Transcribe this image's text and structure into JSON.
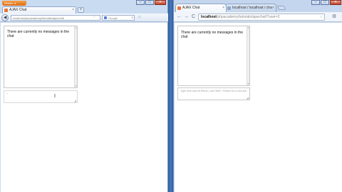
{
  "left_window": {
    "app_button": "Firefox",
    "app_button_caret": "▾",
    "window_controls": {
      "minimize": "–",
      "maximize": "□",
      "close": "✕"
    },
    "tab": {
      "title": "AJAX Chat",
      "close": "×"
    },
    "new_tab": "+",
    "nav": {
      "back": "◀",
      "url": "localhost/phpacademy/tutorials/ajaxchat/",
      "star": "☆",
      "search_placeholder": "Google",
      "search_icon": "⌕",
      "home": "⌂"
    },
    "chat": {
      "empty_message": "There are currently no messages in the chat",
      "cursor": "I",
      "small_mark": "⌐",
      "grip": "◢"
    }
  },
  "right_window": {
    "window_controls": {
      "minimize": "–",
      "maximize": "□",
      "close": "✕"
    },
    "tabs": [
      {
        "title": "AJAX Chat",
        "close": "×",
        "active": true
      },
      {
        "title": "localhost / localhost / cha",
        "close": "×",
        "active": false
      }
    ],
    "toolbar": {
      "back": "←",
      "forward": "→",
      "reload": "C",
      "url_host": "localhost",
      "url_path": "/phpacademy/tutorials/ajaxchat/?user=2",
      "star": "☆",
      "wrench": "⚙"
    },
    "chat": {
      "empty_message": "There are currently no messages in the chat",
      "input_placeholder": "Type here and hit Return. Use Shift + Return for a new line",
      "grip": "◢"
    }
  },
  "colors": {
    "firefox_orange": "#dd6a14",
    "window_frame": "#c9dbf1",
    "desktop_blue": "#3a6cb5"
  }
}
